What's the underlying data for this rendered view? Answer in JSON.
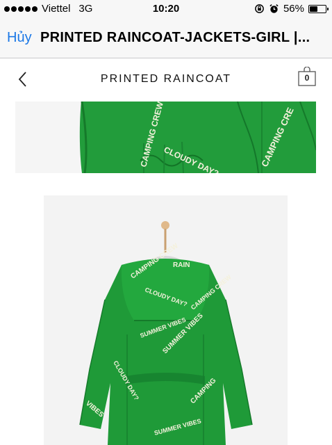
{
  "status_bar": {
    "carrier": "Viettel",
    "network": "3G",
    "time": "10:20",
    "battery": "56%",
    "battery_level": 0.56
  },
  "nav": {
    "cancel_label": "Hủy",
    "title": "PRINTED RAINCOAT-JACKETS-GIRL |..."
  },
  "header": {
    "title": "PRINTED RAINCOAT",
    "cart_count": "0"
  },
  "images": {
    "detail_prints": [
      "CAMPING CREW",
      "CLOUDY DAY?",
      "CAMPING CRE"
    ],
    "main_prints": [
      "CAMPING CREW",
      "RAIN",
      "CLOUDY DAY?",
      "SUMMER VIBES",
      "SUMMER VIBES",
      "CAMPING CREW",
      "CLOUDY DAY?",
      "VIBES",
      "SUMMER VIBES",
      "CAMPING"
    ],
    "jacket_color": "#1f9a38"
  }
}
